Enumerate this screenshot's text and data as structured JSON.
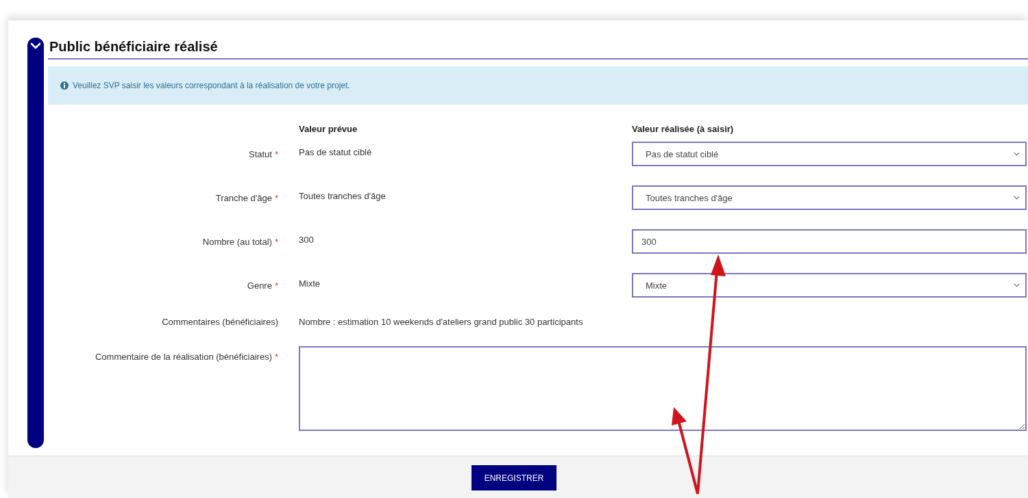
{
  "section": {
    "title": "Public bénéficiaire réalisé",
    "expanded": true
  },
  "info": "Veuillez SVP saisir les valeurs correspondant à la réalisation de votre projet.",
  "headers": {
    "planned": "Valeur prévue",
    "realized": "Valeur réalisée (à saisir)"
  },
  "rows": [
    {
      "kind": "select",
      "label": "Statut",
      "required": true,
      "planned": "Pas de statut ciblé",
      "value": "Pas de statut ciblé"
    },
    {
      "kind": "select",
      "label": "Tranche d'âge",
      "required": true,
      "planned": "Toutes tranches d'âge",
      "value": "Toutes tranches d'âge"
    },
    {
      "kind": "input",
      "label": "Nombre (au total)",
      "required": true,
      "planned": "300",
      "value": "300"
    },
    {
      "kind": "select",
      "label": "Genre",
      "required": true,
      "planned": "Mixte",
      "value": "Mixte"
    },
    {
      "kind": "text",
      "label": "Commentaires (bénéficiaires)",
      "required": false,
      "planned": "Nombre : estimation 10 weekends d'ateliers grand public 30 participants"
    },
    {
      "kind": "textarea",
      "label": "Commentaire de la réalisation (bénéficiaires)",
      "required": true
    }
  ],
  "required_mark": "*",
  "save_button": "ENREGISTRER"
}
